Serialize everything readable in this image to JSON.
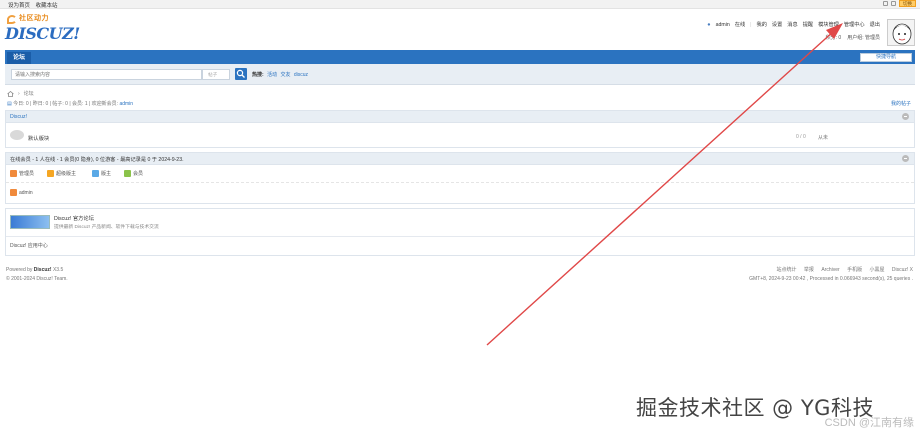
{
  "topbar": {
    "set_home": "设为首页",
    "favorite": "收藏本站",
    "style_label": "切换"
  },
  "logo": {
    "cn": "社区动力",
    "en": "DISCUZ!"
  },
  "usernav": {
    "username": "admin",
    "online": "在线",
    "items": [
      "我的",
      "设置",
      "消息",
      "提醒",
      "模块管理",
      "管理中心",
      "退出"
    ]
  },
  "usernav2": {
    "points": "积分: 0",
    "usergroup": "用户组: 管理员"
  },
  "navbar": {
    "tab": "论坛",
    "quicknav": "快捷导航"
  },
  "search": {
    "placeholder": "请输入搜索内容",
    "type": "帖子",
    "hot_label": "热搜:",
    "hot_keywords": [
      "活动",
      "交友",
      "discuz"
    ]
  },
  "breadcrumb": {
    "home_icon": "home-icon",
    "current": "论坛"
  },
  "stats": {
    "text": "今日: 0 | 昨日: 0 | 帖子: 0 | 会员: 1 | 欢迎新会员:",
    "new_member": "admin",
    "my_posts": "我的帖子"
  },
  "forum_panel": {
    "category": "Discuz!",
    "forums": [
      {
        "name": "默认版块",
        "count": "0 / 0",
        "last": "从未"
      }
    ]
  },
  "online_panel": {
    "title": "在线会员 - 1 人在线 - 1 会员(0 隐身), 0 位游客 - 最高记录是 0 于 2024-9-23.",
    "legend": [
      {
        "label": "管理员",
        "color": "#f08a3c"
      },
      {
        "label": "超级版主",
        "color": "#f5a623"
      },
      {
        "label": "版主",
        "color": "#5aa9e6"
      },
      {
        "label": "会员",
        "color": "#8bc34a"
      }
    ],
    "user": "admin"
  },
  "links_panel": {
    "title": "Discuz! 官方论坛",
    "desc": "提供最新 Discuz! 产品新闻、软件下载与技术交流",
    "app_center": "Discuz! 应用中心"
  },
  "footer": {
    "powered_by": "Powered by",
    "brand": "Discuz!",
    "version": "X3.5",
    "copyright": "© 2001-2024 Discuz! Team.",
    "links": [
      "站点统计",
      "举报",
      "Archiver",
      "手机版",
      "小黑屋",
      "Discuz! X"
    ],
    "info": "GMT+8, 2024-9-23 00:42 , Processed in 0.066943 second(s), 25 queries ."
  },
  "annotation": {
    "watermark": "掘金技术社区 @ YG科技",
    "csdn": "CSDN @江南有缘",
    "arrow_color": "#e04848"
  }
}
